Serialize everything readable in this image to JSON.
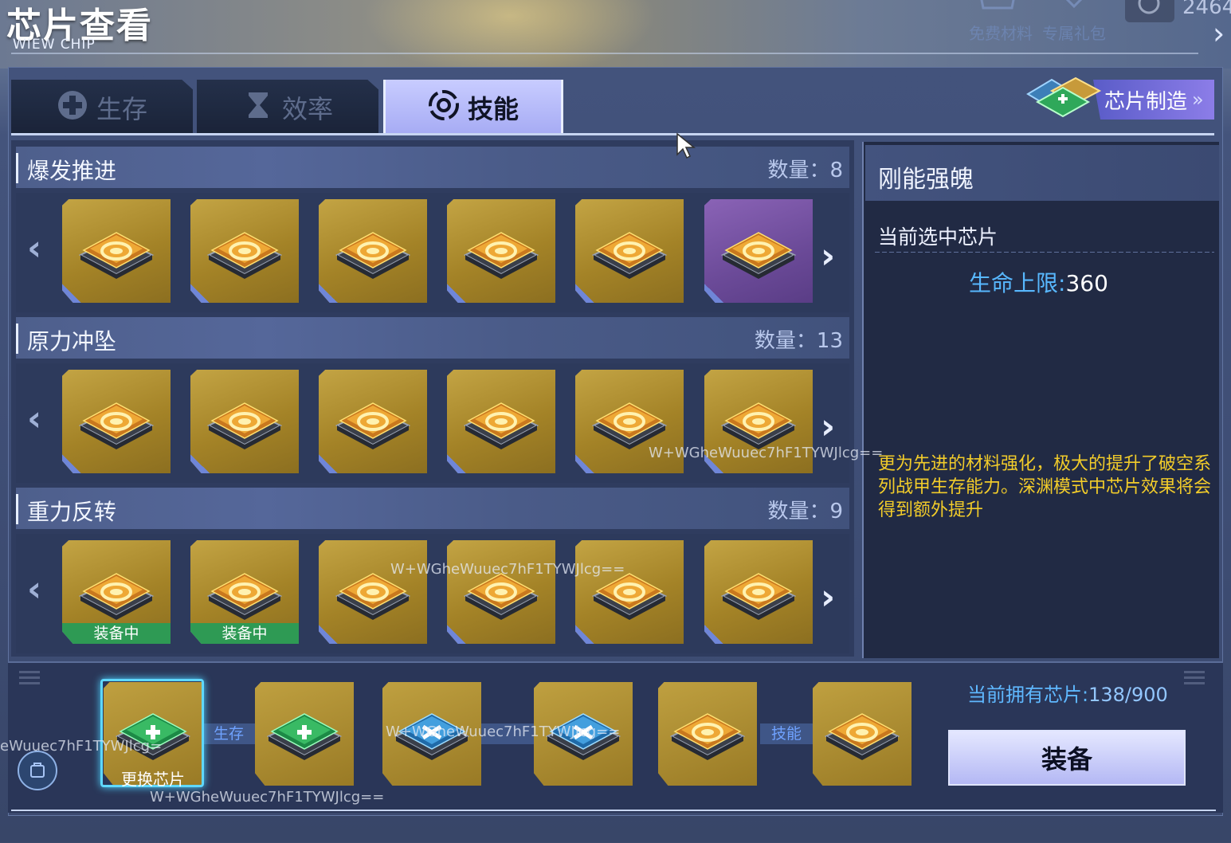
{
  "header": {
    "title": "芯片查看",
    "subtitle": "WIEW CHIP",
    "top_right_links": [
      "免费材料",
      "专属礼包"
    ],
    "currency": "2464"
  },
  "tabs": [
    {
      "label": "生存",
      "icon": "plus-cross-icon",
      "active": false
    },
    {
      "label": "效率",
      "icon": "hourglass-icon",
      "active": false
    },
    {
      "label": "技能",
      "icon": "target-icon",
      "active": true
    }
  ],
  "make_button": {
    "label": "芯片制造",
    "icon": "chevron-right-double-icon"
  },
  "sections": [
    {
      "title": "爆发推进",
      "count_label": "数量：",
      "count": "8",
      "chips": [
        {
          "color": "gold"
        },
        {
          "color": "gold"
        },
        {
          "color": "gold"
        },
        {
          "color": "gold"
        },
        {
          "color": "gold"
        },
        {
          "color": "purple"
        }
      ]
    },
    {
      "title": "原力冲坠",
      "count_label": "数量：",
      "count": "13",
      "chips": [
        {
          "color": "gold"
        },
        {
          "color": "gold"
        },
        {
          "color": "gold"
        },
        {
          "color": "gold"
        },
        {
          "color": "gold"
        },
        {
          "color": "gold"
        }
      ]
    },
    {
      "title": "重力反转",
      "count_label": "数量：",
      "count": "9",
      "chips": [
        {
          "color": "gold",
          "badge": "装备中"
        },
        {
          "color": "gold",
          "badge": "装备中"
        },
        {
          "color": "gold"
        },
        {
          "color": "gold"
        },
        {
          "color": "gold"
        },
        {
          "color": "gold"
        }
      ]
    }
  ],
  "detail": {
    "title": "刚能强魄",
    "selected_label": "当前选中芯片",
    "stat_key": "生命上限:",
    "stat_value": "360",
    "description": "更为先进的材料强化，极大的提升了破空系列战甲生存能力。深渊模式中芯片效果将会得到额外提升"
  },
  "bottom": {
    "slots": [
      {
        "chip": "green"
      },
      {
        "chip": "green"
      },
      {
        "chip": "blue"
      },
      {
        "chip": "blue"
      },
      {
        "chip": "gold"
      },
      {
        "chip": "gold"
      }
    ],
    "connectors": [
      "生存",
      "",
      "技能"
    ],
    "change_label": "更换芯片",
    "owned_label": "当前拥有芯片:",
    "owned_value": "138/900",
    "equip_label": "装备"
  },
  "watermark": "W+WGheWuuec7hF1TYWJlcg==",
  "watermark_partial": "eWuuec7hF1TYWJlcg=",
  "colors": {
    "accent": "#a6abf4",
    "gold": "#b89a38",
    "detail_text": "#f2cc2a",
    "stat_key": "#58b8ff"
  }
}
